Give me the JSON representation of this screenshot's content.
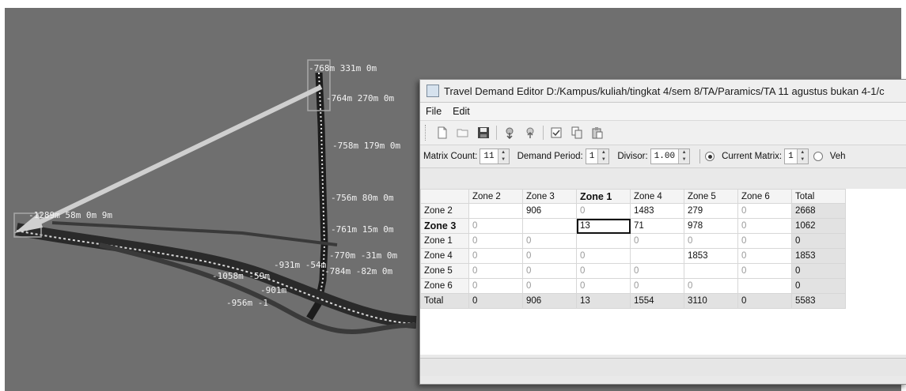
{
  "network": {
    "labels": [
      "-768m 331m 0m",
      "-764m 270m 0m",
      "-758m 179m 0m",
      "-756m 80m 0m",
      "-761m 15m 0m",
      "-770m -31m 0m",
      "-931m -54m",
      "-784m -82m 0m",
      "-1058m -59m",
      "-901m",
      "-956m -1",
      "-1289m 58m 0m 9m"
    ]
  },
  "editor": {
    "title": "Travel Demand Editor D:/Kampus/kuliah/tingkat 4/sem 8/TA/Paramics/TA 11 agustus bukan 4-1/c",
    "menu": [
      "File",
      "Edit"
    ],
    "toolbar_icons": [
      "new-icon",
      "open-icon",
      "save-icon",
      "import-icon",
      "export-icon",
      "edit-icon",
      "copy-icon",
      "paste-icon"
    ],
    "options": {
      "matrix_count_label": "Matrix Count:",
      "matrix_count_value": "11",
      "demand_period_label": "Demand Period:",
      "demand_period_value": "1",
      "divisor_label": "Divisor:",
      "divisor_value": "1.00",
      "current_matrix_label": "Current Matrix:",
      "current_matrix_value": "1",
      "veh_label": "Veh"
    },
    "table": {
      "columns": [
        "Zone 2",
        "Zone 3",
        "Zone 1",
        "Zone 4",
        "Zone 5",
        "Zone 6",
        "Total"
      ],
      "rows": [
        {
          "label": "Zone 2",
          "cells": [
            "",
            "906",
            "0",
            "1483",
            "279",
            "0",
            "2668"
          ]
        },
        {
          "label": "Zone 3",
          "cells": [
            "0",
            "",
            "13",
            "71",
            "978",
            "0",
            "1062"
          ]
        },
        {
          "label": "Zone 1",
          "cells": [
            "0",
            "0",
            "",
            "0",
            "0",
            "0",
            "0"
          ]
        },
        {
          "label": "Zone 4",
          "cells": [
            "0",
            "0",
            "0",
            "",
            "1853",
            "0",
            "1853"
          ]
        },
        {
          "label": "Zone 5",
          "cells": [
            "0",
            "0",
            "0",
            "0",
            "",
            "0",
            "0"
          ]
        },
        {
          "label": "Zone 6",
          "cells": [
            "0",
            "0",
            "0",
            "0",
            "0",
            "",
            "0"
          ]
        },
        {
          "label": "Total",
          "cells": [
            "0",
            "906",
            "13",
            "1554",
            "3110",
            "0",
            "5583"
          ]
        }
      ]
    }
  }
}
